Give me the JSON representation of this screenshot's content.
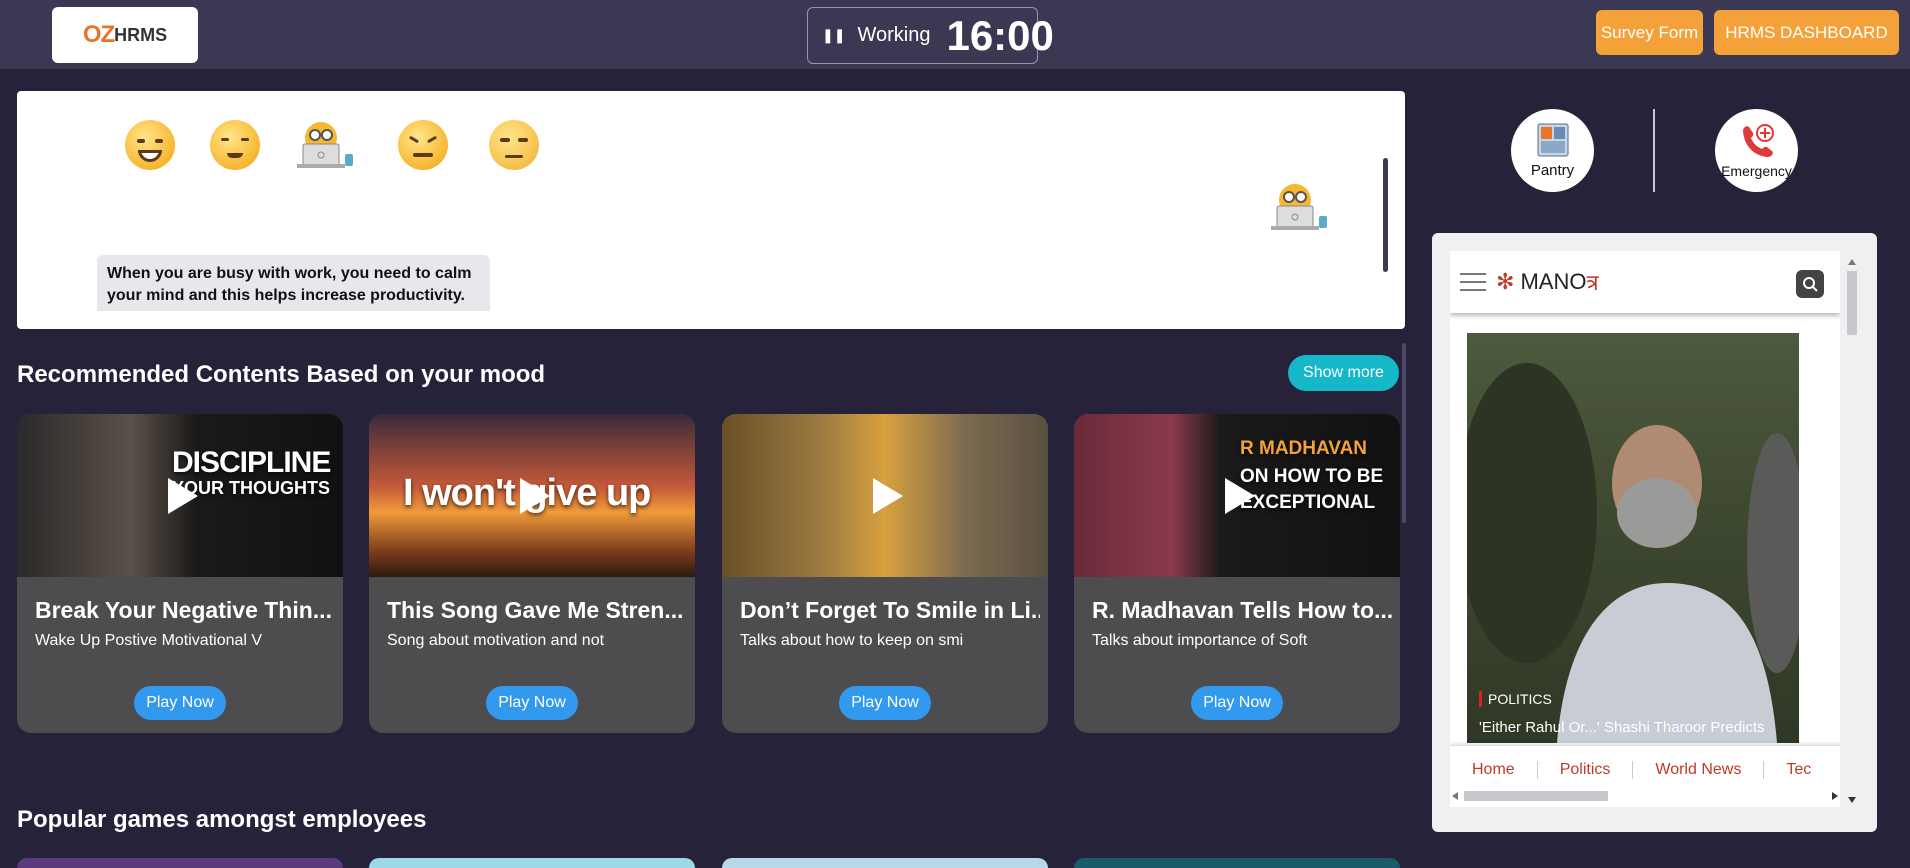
{
  "header": {
    "logo_oz": "OZ",
    "logo_hrms": "HRMS",
    "timer_icon": "pause-icon",
    "status": "Working",
    "time": "16:00",
    "survey_label": "Survey Form",
    "dashboard_label": "HRMS DASHBOARD"
  },
  "mood": {
    "options": [
      "grinning-face",
      "relieved-face",
      "busy-laptop",
      "confounded-face",
      "annoyed-face"
    ],
    "selected": "busy-laptop",
    "message": "When you are busy with work, you need to calm your mind and this helps increase productivity."
  },
  "recommended": {
    "title": "Recommended Contents Based on your mood",
    "show_more": "Show more",
    "cards": [
      {
        "thumb_line1": "DISCIPLINE",
        "thumb_line2": "YOUR THOUGHTS",
        "title": "Break Your Negative Thin...",
        "desc": "Wake Up Postive Motivational V",
        "button": "Play Now"
      },
      {
        "thumb_line1": "I won't give up",
        "thumb_line2": "",
        "title": "This Song Gave Me Stren...",
        "desc": "Song about motivation and not",
        "button": "Play Now"
      },
      {
        "thumb_line1": "",
        "thumb_line2": "",
        "title": "Don’t Forget To Smile in Li...",
        "desc": "Talks about how to keep on smi",
        "button": "Play Now"
      },
      {
        "thumb_line1": "R MADHAVAN",
        "thumb_line2": "ON HOW TO BE EXCEPTIONAL",
        "title": "R. Madhavan Tells How to...",
        "desc": "Talks about importance of Soft",
        "button": "Play Now"
      }
    ]
  },
  "games": {
    "title": "Popular games amongst employees"
  },
  "quick_links": {
    "pantry": "Pantry",
    "emergency": "Emergency"
  },
  "news": {
    "brand": "MANO",
    "brand_suffix": "त्र",
    "category": "POLITICS",
    "headline": "'Either Rahul Or...' Shashi Tharoor Predicts",
    "nav": [
      "Home",
      "Politics",
      "World News",
      "Tec"
    ]
  },
  "colors": {
    "topbar": "#3a3852",
    "background": "#25223a",
    "accent_orange": "#f4a13a",
    "accent_teal": "#14b8c9",
    "play_blue": "#3399ee",
    "card": "#4d4d4f"
  }
}
